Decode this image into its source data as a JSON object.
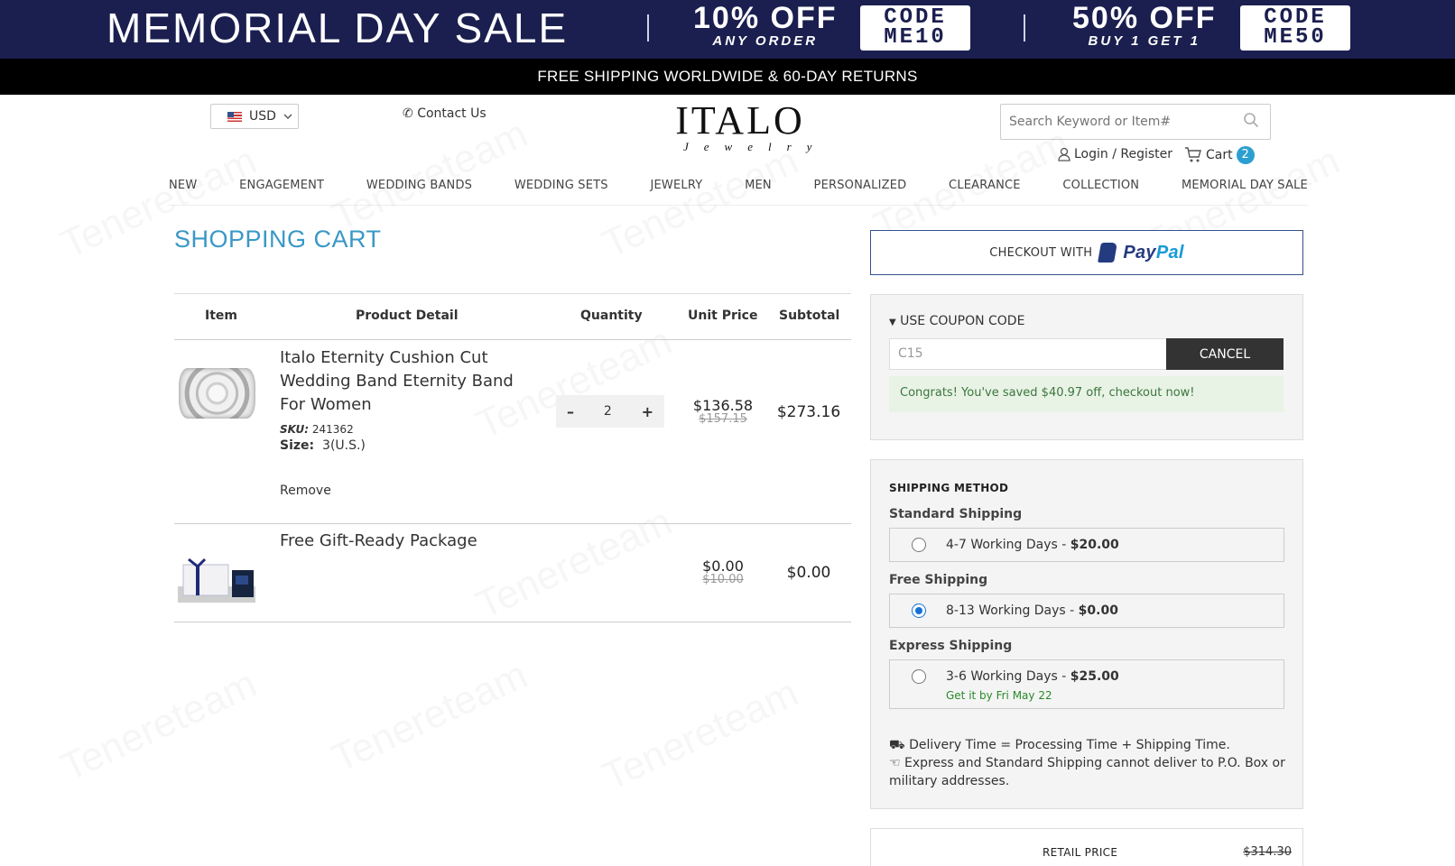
{
  "promo": {
    "title": "MEMORIAL DAY SALE",
    "offer1": {
      "big": "10% OFF",
      "small": "ANY ORDER",
      "code_line1": "CODE",
      "code_line2": "ME10"
    },
    "offer2": {
      "big": "50% OFF",
      "small": "BUY 1 GET 1",
      "code_line1": "CODE",
      "code_line2": "ME50"
    },
    "colors": {
      "banner_bg": "#1b1f4f"
    }
  },
  "shipbar": {
    "text": "FREE SHIPPING WORLDWIDE & 60-DAY RETURNS"
  },
  "header": {
    "currency": "USD",
    "contact": "Contact Us",
    "logo_brand": "ITALO",
    "logo_sub": "Jewelry",
    "search_placeholder": "Search Keyword or Item#",
    "login": "Login / Register",
    "cart": "Cart",
    "cart_count": "2"
  },
  "nav": [
    "NEW",
    "ENGAGEMENT",
    "WEDDING BANDS",
    "WEDDING SETS",
    "JEWELRY",
    "MEN",
    "PERSONALIZED",
    "CLEARANCE",
    "COLLECTION",
    "MEMORIAL DAY SALE"
  ],
  "cart": {
    "title": "SHOPPING CART",
    "headers": {
      "item": "Item",
      "detail": "Product Detail",
      "quantity": "Quantity",
      "unit_price": "Unit Price",
      "subtotal": "Subtotal"
    },
    "items": [
      {
        "name": "Italo Eternity Cushion Cut Wedding Band Eternity Band For Women",
        "sku_label": "SKU:",
        "sku": "241362",
        "size_label": "Size:",
        "size": "3(U.S.)",
        "remove": "Remove",
        "quantity": "2",
        "unit_price": "$136.58",
        "old_price": "$157.15",
        "subtotal": "$273.16"
      },
      {
        "name": "Free Gift-Ready Package",
        "unit_price": "$0.00",
        "old_price": "$10.00",
        "subtotal": "$0.00"
      }
    ]
  },
  "checkout": {
    "paypal_prefix": "CHECKOUT WITH",
    "paypal_pay": "Pay",
    "paypal_pal": "Pal"
  },
  "coupon": {
    "heading": "USE COUPON CODE",
    "value": "C15",
    "button": "CANCEL",
    "message": "Congrats! You've saved $40.97 off, checkout now!"
  },
  "shipping": {
    "title": "SHIPPING METHOD",
    "options": [
      {
        "label": "Standard Shipping",
        "days": "4-7 Working Days - ",
        "price": "$20.00",
        "selected": false
      },
      {
        "label": "Free Shipping",
        "days": "8-13 Working Days - ",
        "price": "$0.00",
        "selected": true
      },
      {
        "label": "Express Shipping",
        "days": "3-6 Working Days - ",
        "price": "$25.00",
        "eta": "Get it by Fri May 22",
        "selected": false
      }
    ],
    "note1": "Delivery Time = Processing Time + Shipping Time.",
    "note2": "Express and Standard Shipping cannot deliver to P.O. Box or military addresses."
  },
  "summary": {
    "retail_label": "RETAIL PRICE",
    "retail_value": "$314.30"
  },
  "watermark": "Tenereteam"
}
